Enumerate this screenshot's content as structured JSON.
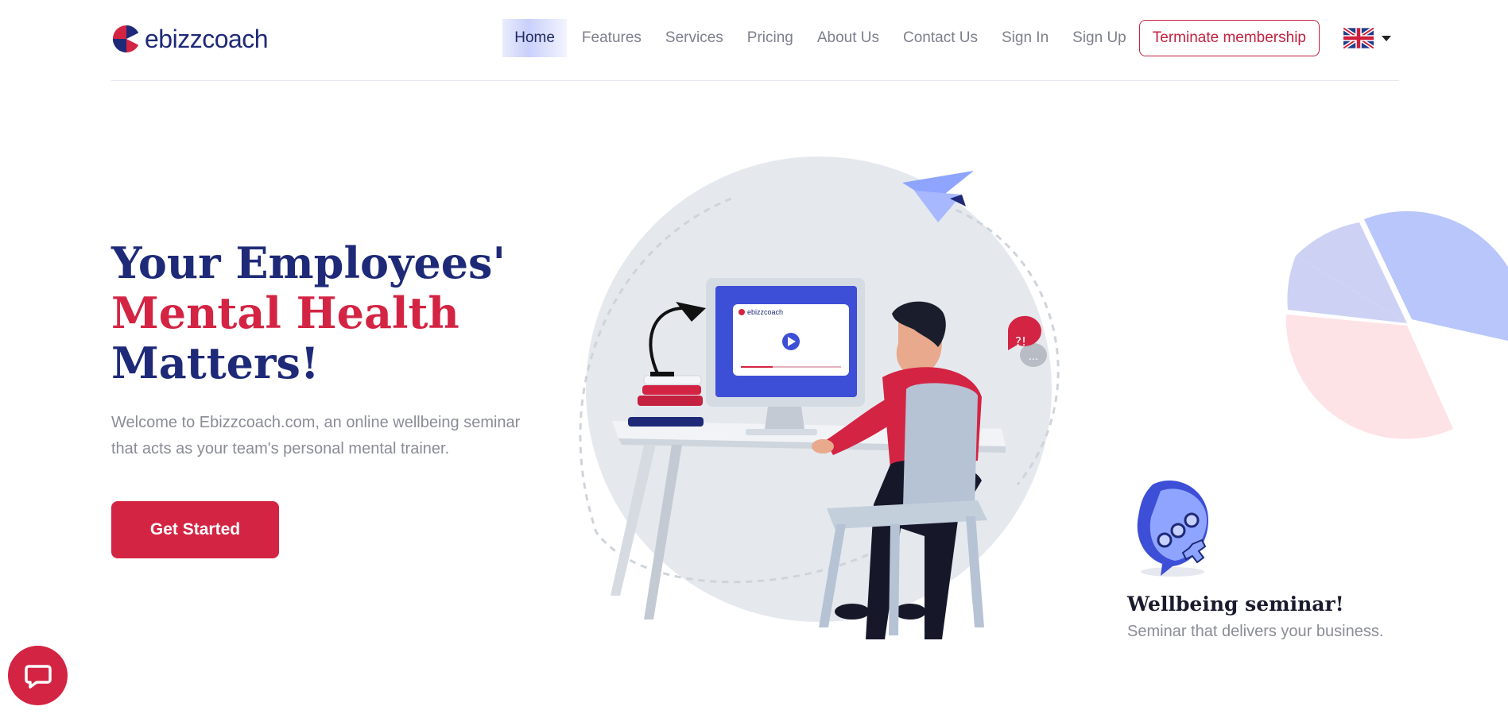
{
  "brand": {
    "name": "ebizzcoach"
  },
  "nav": {
    "items": [
      {
        "label": "Home"
      },
      {
        "label": "Features"
      },
      {
        "label": "Services"
      },
      {
        "label": "Pricing"
      },
      {
        "label": "About Us"
      },
      {
        "label": "Contact Us"
      },
      {
        "label": "Sign In"
      },
      {
        "label": "Sign Up"
      }
    ],
    "terminate_label": "Terminate membership",
    "language_icon": "uk-flag-icon"
  },
  "hero": {
    "title_line1": "Your Employees'",
    "title_line2": "Mental Health",
    "title_line3": "Matters!",
    "description": "Welcome to Ebizzcoach.com, an online wellbeing seminar that acts as your team's personal mental trainer.",
    "cta_label": "Get Started"
  },
  "illustration": {
    "screen_brand": "ebizzcoach",
    "bubble_text": "?!",
    "bubble_dots": "..."
  },
  "feature": {
    "title": "Wellbeing seminar!",
    "subtitle": "Seminar that delivers your business."
  },
  "colors": {
    "primary": "#1e2a78",
    "accent": "#d42443",
    "text_muted": "#8a8c96"
  },
  "chat_widget": {
    "icon": "chat-bubble-icon"
  }
}
